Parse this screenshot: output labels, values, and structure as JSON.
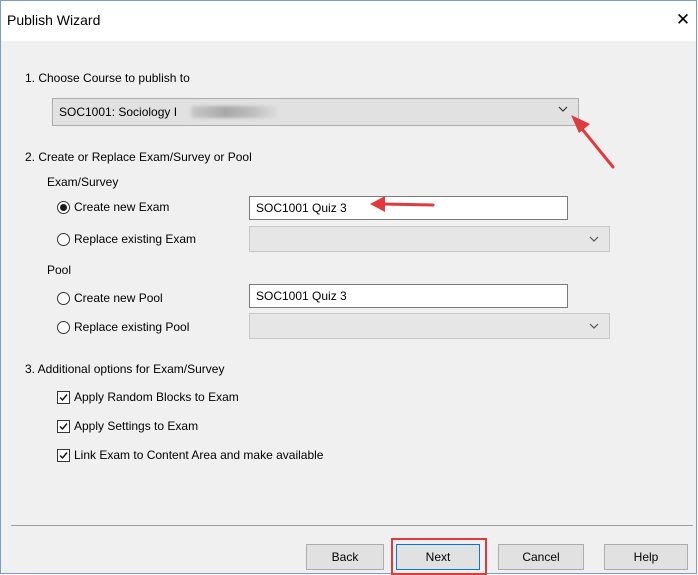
{
  "window": {
    "title": "Publish Wizard",
    "close_glyph": "✕"
  },
  "step1": {
    "heading": "1. Choose Course to publish to",
    "course_value": "SOC1001: Sociology I"
  },
  "step2": {
    "heading": "2. Create or Replace Exam/Survey or Pool",
    "exam_group_label": "Exam/Survey",
    "create_exam_label": "Create new Exam",
    "create_exam_value": "SOC1001 Quiz 3",
    "replace_exam_label": "Replace existing Exam",
    "pool_group_label": "Pool",
    "create_pool_label": "Create new Pool",
    "create_pool_value": "SOC1001 Quiz 3",
    "replace_pool_label": "Replace existing Pool",
    "selected_exam_option": "Create new Exam",
    "selected_pool_option": "Create new Pool"
  },
  "step3": {
    "heading": "3. Additional options for Exam/Survey",
    "options": [
      {
        "label": "Apply Random Blocks to Exam",
        "checked": true
      },
      {
        "label": "Apply Settings to Exam",
        "checked": true
      },
      {
        "label": "Link Exam to Content Area and make available",
        "checked": true
      }
    ]
  },
  "buttons": {
    "back": "Back",
    "next": "Next",
    "cancel": "Cancel",
    "help": "Help"
  },
  "colors": {
    "annotation_red": "#e0393e",
    "default_button_border": "#0078d7"
  }
}
